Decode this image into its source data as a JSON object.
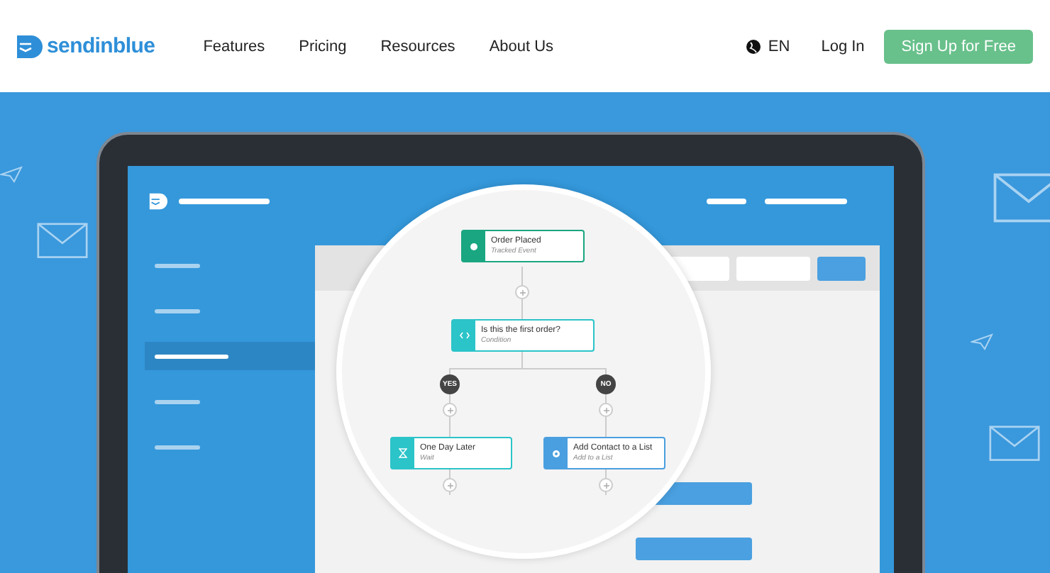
{
  "header": {
    "brand": "sendinblue",
    "nav": [
      "Features",
      "Pricing",
      "Resources",
      "About Us"
    ],
    "language": "EN",
    "login": "Log In",
    "cta": "Sign Up for Free"
  },
  "app_mock": {
    "sidebar_items": [
      {
        "selected": false
      },
      {
        "selected": false
      },
      {
        "selected": true
      },
      {
        "selected": false
      },
      {
        "selected": false
      }
    ]
  },
  "workflow": {
    "start": [
      {
        "kind": "event",
        "title": "Order Placed",
        "subtitle": "Tracked Event"
      },
      {
        "kind": "condition",
        "title": "Is this the first order?",
        "subtitle": "Condition"
      }
    ],
    "branches": [
      {
        "label": "YES",
        "node": {
          "kind": "wait",
          "title": "One Day Later",
          "subtitle": "Wait"
        }
      },
      {
        "label": "NO",
        "node": {
          "kind": "action",
          "title": "Add Contact to a List",
          "subtitle": "Add to a List"
        }
      }
    ]
  }
}
